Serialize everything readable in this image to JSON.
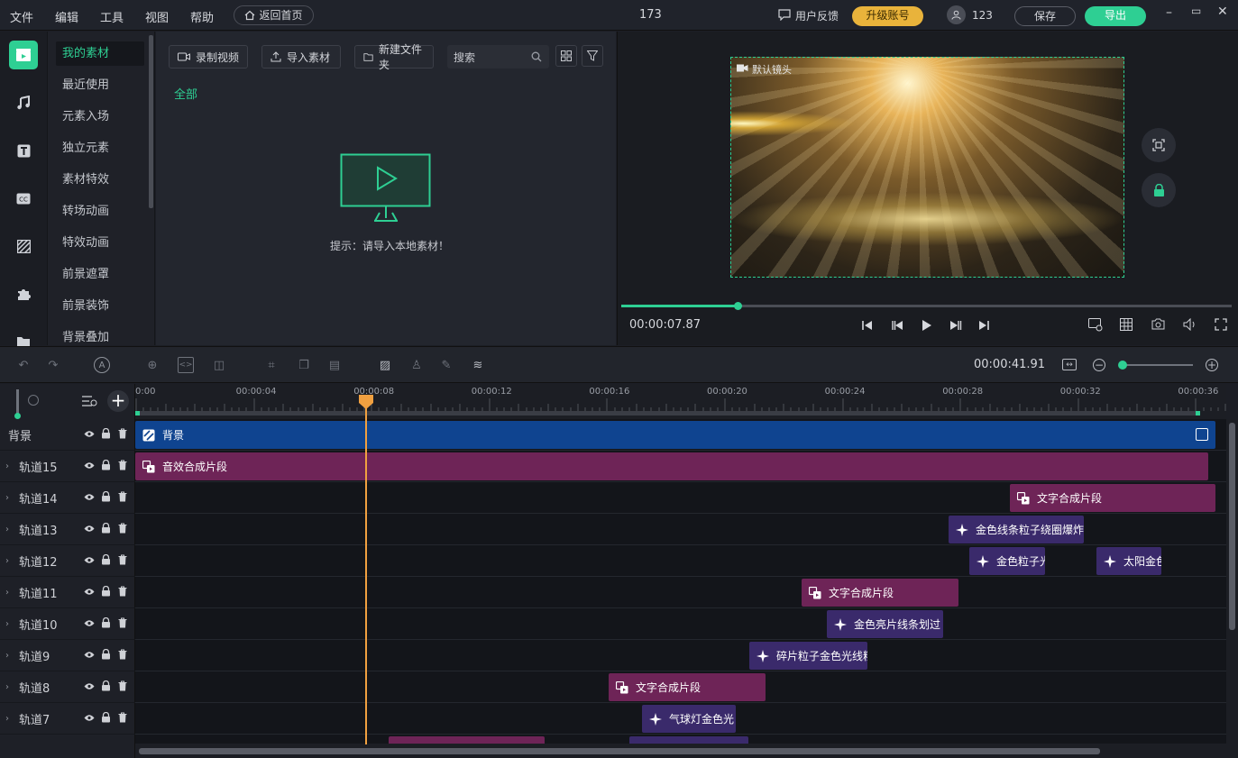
{
  "menu": {
    "file": "文件",
    "edit": "编辑",
    "tools": "工具",
    "view": "视图",
    "help": "帮助",
    "home": "返回首页"
  },
  "project": {
    "title": "173"
  },
  "topright": {
    "feedback": "用户反馈",
    "upgrade": "升级账号",
    "user": "123",
    "save": "保存",
    "export": "导出"
  },
  "categories": [
    "我的素材",
    "最近使用",
    "元素入场",
    "独立元素",
    "素材特效",
    "转场动画",
    "特效动画",
    "前景遮罩",
    "前景装饰",
    "背景叠加"
  ],
  "media": {
    "record": "录制视频",
    "import": "导入素材",
    "newfolder": "新建文件夹",
    "search_placeholder": "搜索",
    "filter_all": "全部",
    "empty_hint": "提示：请导入本地素材！"
  },
  "preview": {
    "camera_label": "默认镜头",
    "current_time": "00:00:07.87",
    "progress": 0.19
  },
  "timeline": {
    "total_time": "00:00:41.91",
    "ticks": [
      "0:00",
      "00:00:04",
      "00:00:08",
      "00:00:12",
      "00:00:16",
      "00:00:20",
      "00:00:24",
      "00:00:28",
      "00:00:32",
      "00:00:36"
    ]
  },
  "tracks": [
    {
      "name": "背景",
      "clips": [
        {
          "label": "背景",
          "kind": "bg"
        }
      ]
    },
    {
      "name": "轨道15",
      "clips": [
        {
          "label": "音效合成片段",
          "kind": "txt"
        }
      ]
    },
    {
      "name": "轨道14",
      "clips": [
        {
          "label": "文字合成片段",
          "kind": "txt"
        }
      ]
    },
    {
      "name": "轨道13",
      "clips": [
        {
          "label": "金色线条粒子绕圈爆炸",
          "kind": "fx"
        }
      ]
    },
    {
      "name": "轨道12",
      "clips": [
        {
          "label": "金色粒子光",
          "kind": "fx"
        },
        {
          "label": "太阳金色",
          "kind": "fx"
        }
      ]
    },
    {
      "name": "轨道11",
      "clips": [
        {
          "label": "文字合成片段",
          "kind": "txt"
        }
      ]
    },
    {
      "name": "轨道10",
      "clips": [
        {
          "label": "金色亮片线条划过",
          "kind": "fx"
        }
      ]
    },
    {
      "name": "轨道9",
      "clips": [
        {
          "label": "碎片粒子金色光线粒",
          "kind": "fx"
        }
      ]
    },
    {
      "name": "轨道8",
      "clips": [
        {
          "label": "文字合成片段",
          "kind": "txt"
        }
      ]
    },
    {
      "name": "轨道7",
      "clips": [
        {
          "label": "气球灯金色光",
          "kind": "fx"
        }
      ]
    }
  ],
  "colors": {
    "accent": "#2ecf93",
    "upgrade": "#e9b33b",
    "playhead": "#f0a040"
  }
}
